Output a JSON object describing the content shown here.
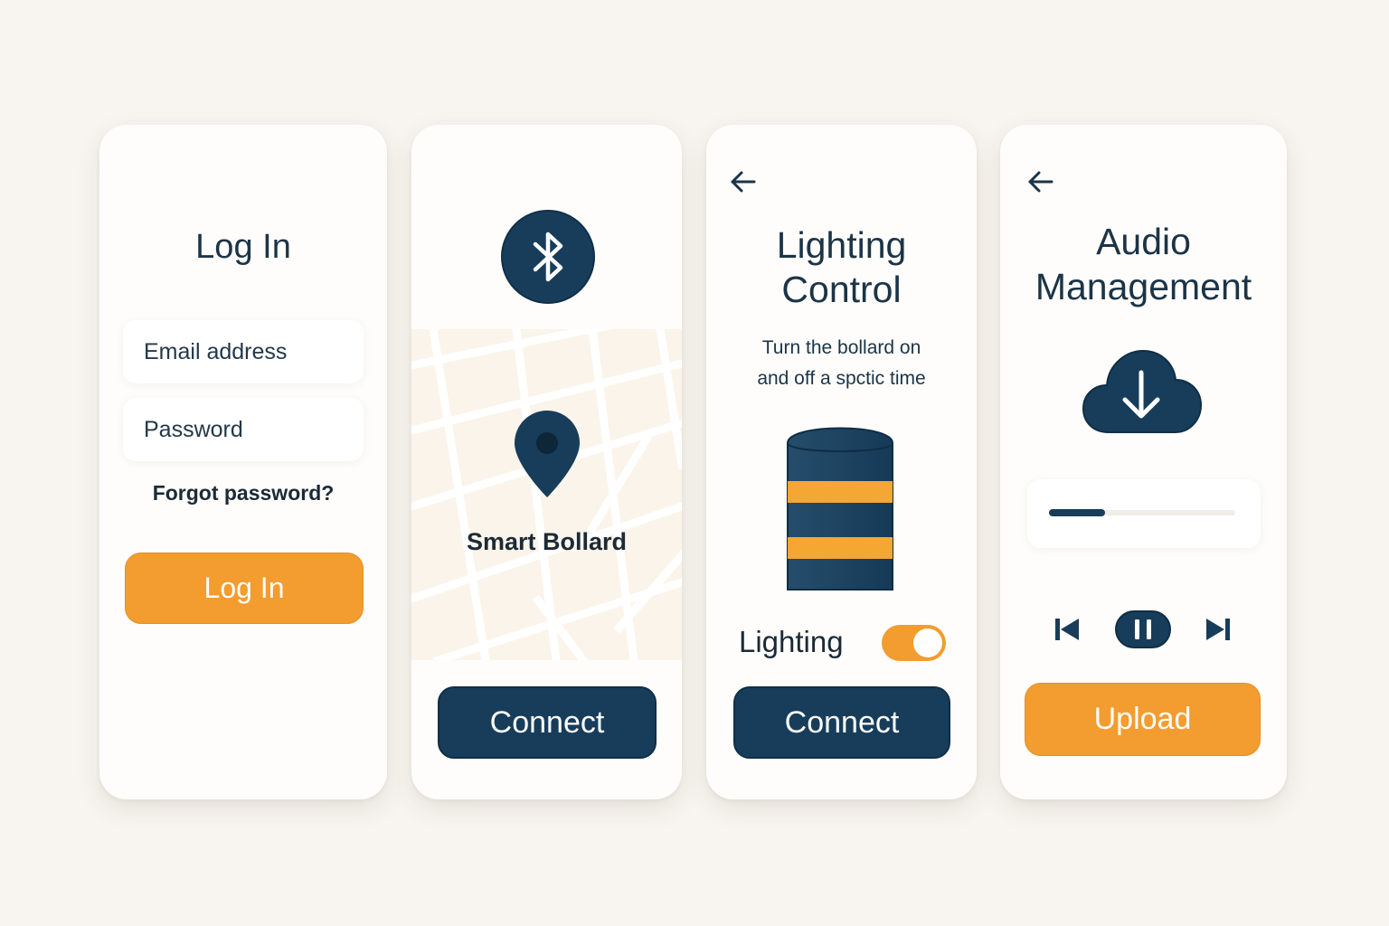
{
  "screens": {
    "login": {
      "title": "Log In",
      "email_placeholder": "Email address",
      "password_placeholder": "Password",
      "forgot_link": "Forgot password?",
      "login_button": "Log In"
    },
    "bluetooth": {
      "icon": "bluetooth-icon",
      "map_pin_icon": "map-pin-icon",
      "device_name": "Smart Bollard",
      "connect_button": "Connect"
    },
    "lighting": {
      "back_icon": "arrow-left-icon",
      "title_line1": "Lighting",
      "title_line2": "Control",
      "desc_line1": "Turn the bollard on",
      "desc_line2": "and off a spctic time",
      "toggle_label": "Lighting",
      "toggle_on": true,
      "connect_button": "Connect"
    },
    "audio": {
      "back_icon": "arrow-left-icon",
      "title_line1": "Audio",
      "title_line2": "Management",
      "cloud_icon": "cloud-download-icon",
      "progress": 0.3,
      "controls": [
        "skip-back-icon",
        "pause-icon",
        "skip-forward-icon"
      ],
      "upload_button": "Upload"
    }
  },
  "colors": {
    "navy": "#173d5b",
    "orange": "#f39c2f",
    "background": "#f8f5f0",
    "card": "#fefdfb"
  }
}
